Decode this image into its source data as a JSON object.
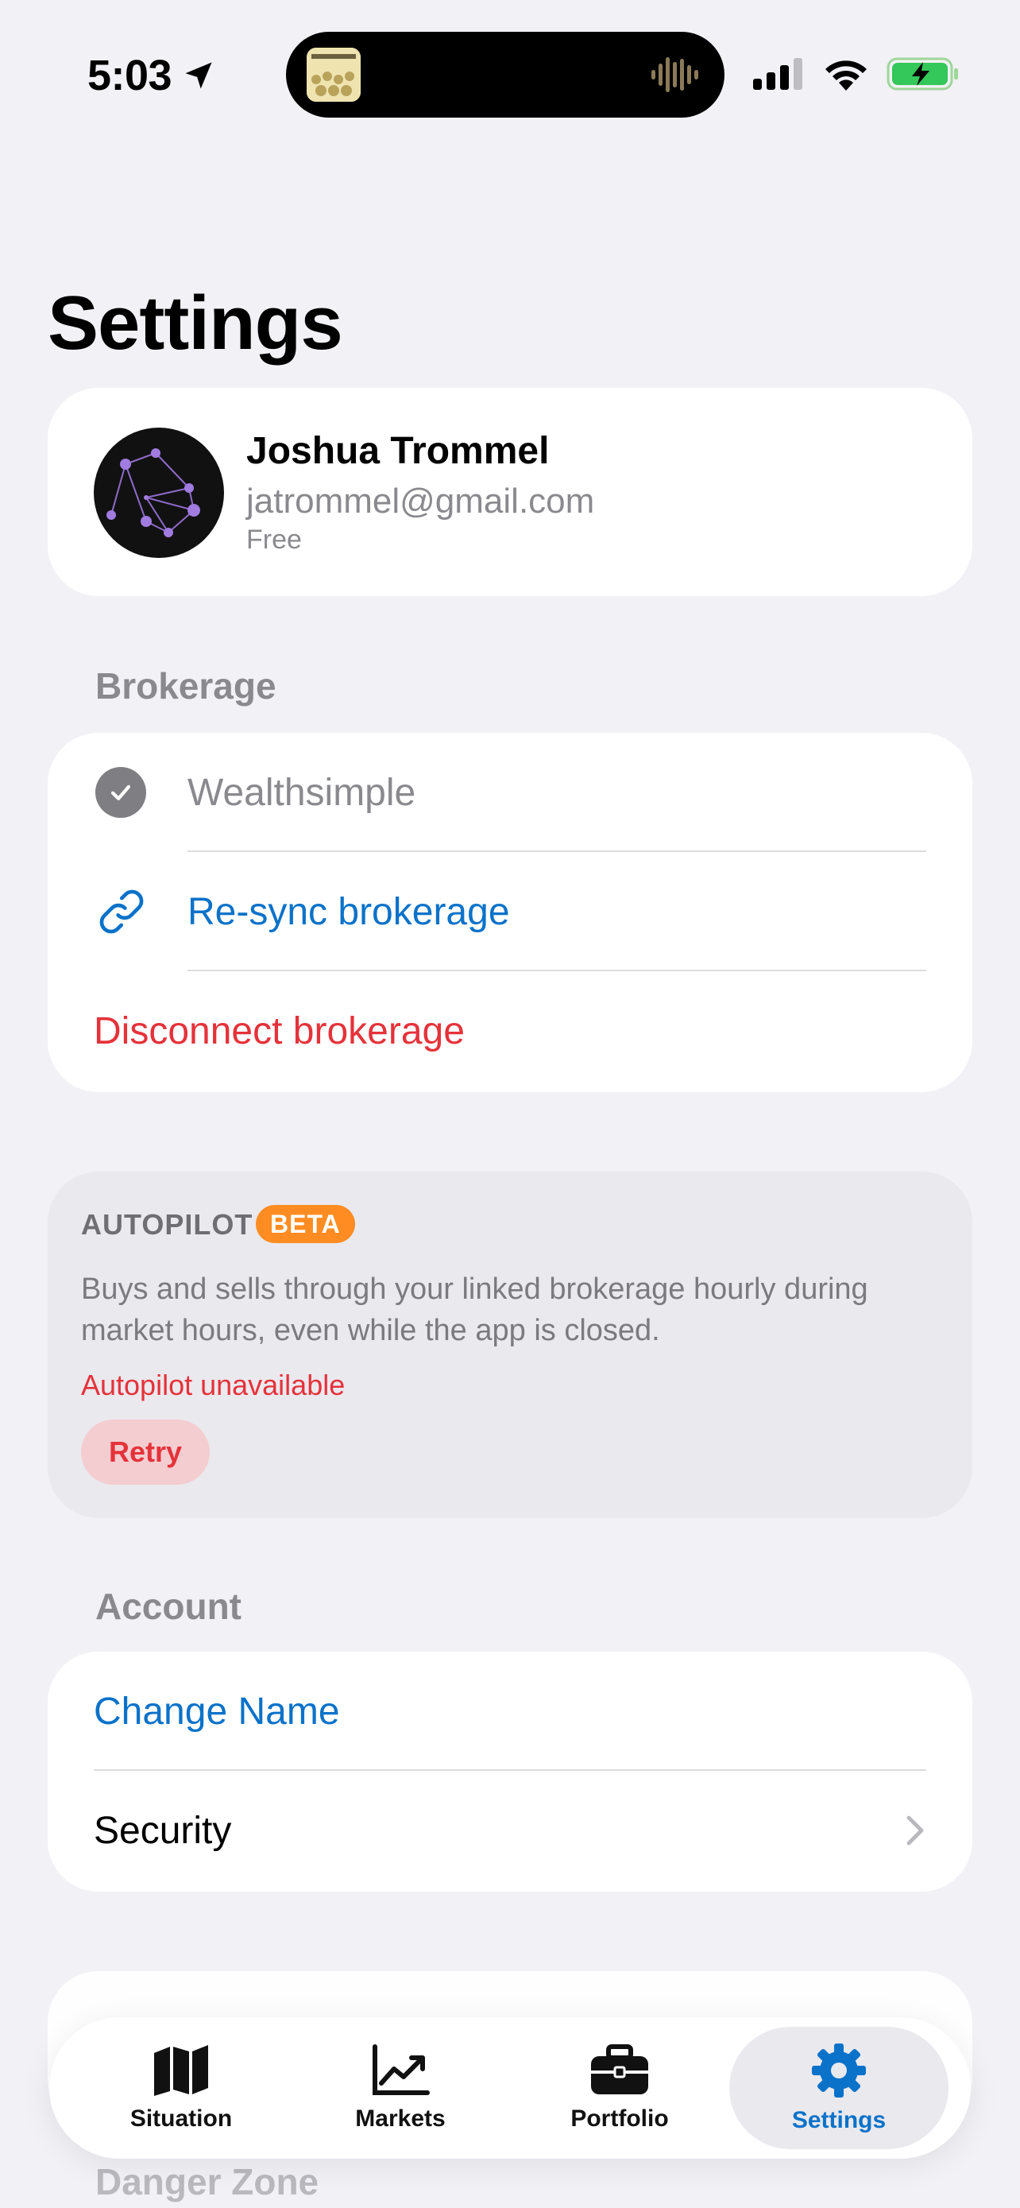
{
  "status_bar": {
    "time": "5:03"
  },
  "page": {
    "title": "Settings"
  },
  "profile": {
    "name": "Joshua Trommel",
    "email": "jatrommel@gmail.com",
    "plan": "Free"
  },
  "brokerage": {
    "header": "Brokerage",
    "connected_name": "Wealthsimple",
    "resync_label": "Re-sync brokerage",
    "disconnect_label": "Disconnect brokerage"
  },
  "autopilot": {
    "title": "AUTOPILOT",
    "badge": "BETA",
    "description": "Buys and sells through your linked brokerage hourly during market hours, even while the app is closed.",
    "error": "Autopilot unavailable",
    "retry_label": "Retry"
  },
  "account": {
    "header": "Account",
    "change_name_label": "Change Name",
    "security_label": "Security"
  },
  "danger_zone": {
    "header": "Danger Zone"
  },
  "tabbar": {
    "tabs": [
      {
        "label": "Situation",
        "icon": "map-icon"
      },
      {
        "label": "Markets",
        "icon": "chart-line-icon"
      },
      {
        "label": "Portfolio",
        "icon": "briefcase-icon"
      },
      {
        "label": "Settings",
        "icon": "gear-icon"
      }
    ],
    "active": "Settings"
  },
  "colors": {
    "background": "#F2F1F6",
    "accent_blue": "#0A72C9",
    "danger_red": "#E5323A",
    "beta_orange": "#FF8C22",
    "secondary_text": "#8A8A8E"
  }
}
